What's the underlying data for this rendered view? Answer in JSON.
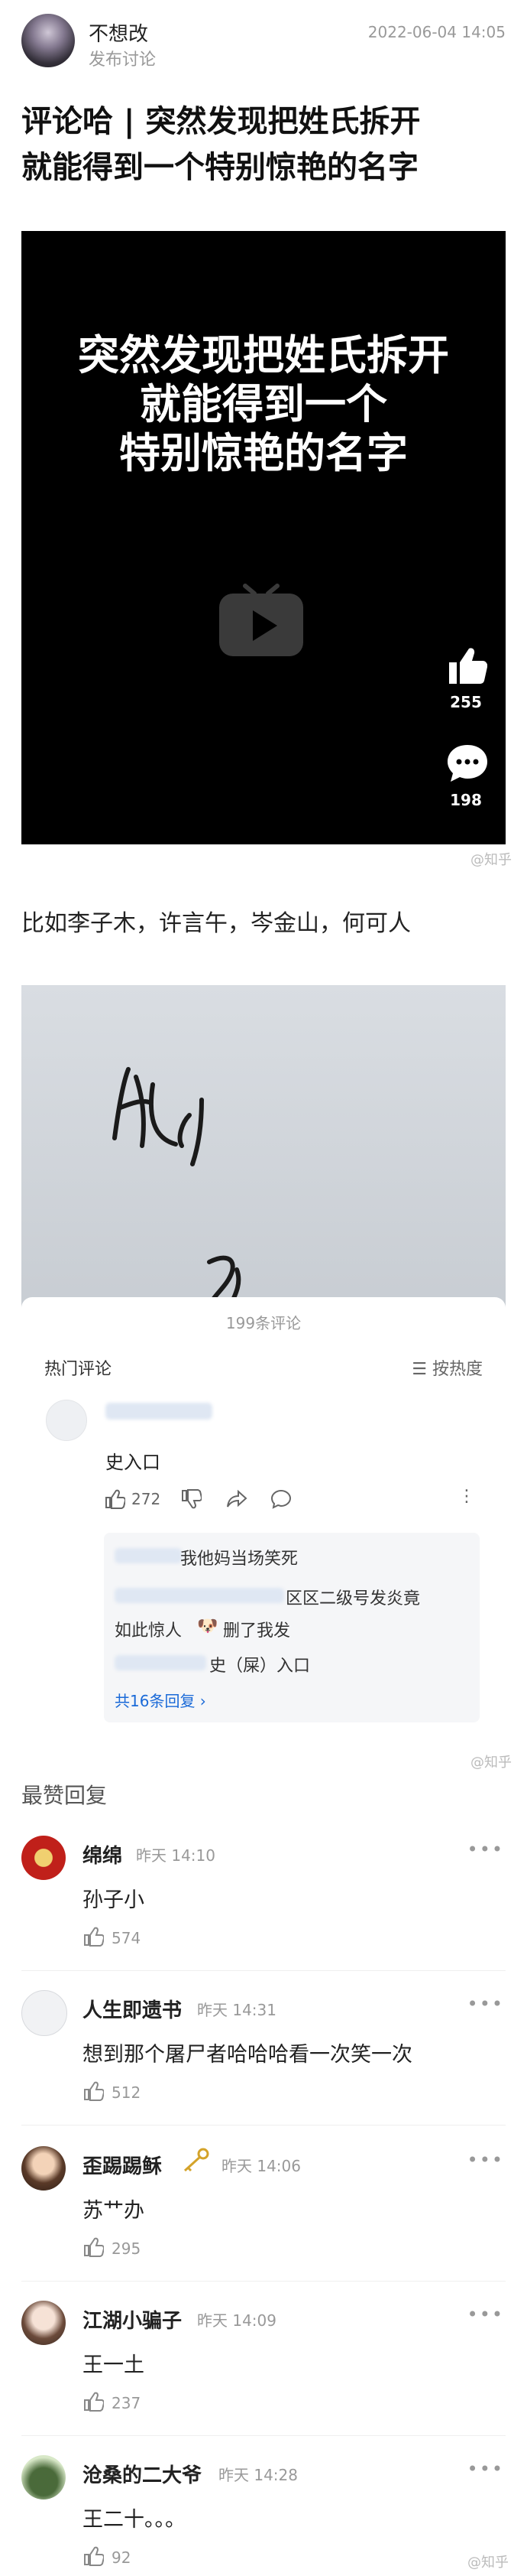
{
  "post": {
    "author": "不想改",
    "subtitle": "发布讨论",
    "timestamp": "2022-06-04 14:05",
    "title_line1": "评论哈 | 突然发现把姓氏拆开",
    "title_line2": "就能得到一个特别惊艳的名字",
    "body_text": "比如李子木，许言午，岑金山，何可人",
    "watermark": "@知乎"
  },
  "video": {
    "overlay_line1": "突然发现把姓氏拆开",
    "overlay_line2": "就能得到一个",
    "overlay_line3": "特别惊艳的名字",
    "like_count": "255",
    "comment_count": "198"
  },
  "screenshot_card": {
    "comment_total": "199条评论",
    "hot_label": "热门评论",
    "sort_label": "按热度",
    "top_comment_text": "史入口",
    "top_comment_likes": "272",
    "reply1_text": "我他妈当场笑死",
    "reply2_text": "区区二级号发炎竟",
    "reply3_text": "如此惊人",
    "reply3_suffix": "删了我发",
    "reply4_text": "史（屎）入口",
    "more_replies": "共16条回复",
    "watermark": "@知乎"
  },
  "replies_section": {
    "title": "最赞回复",
    "items": [
      {
        "name": "绵绵",
        "time": "昨天 14:10",
        "text": "孙子小",
        "likes": "574"
      },
      {
        "name": "人生即遗书",
        "time": "昨天 14:31",
        "text": "想到那个屠尸者哈哈哈看一次笑一次",
        "likes": "512"
      },
      {
        "name": "歪踢踢稣",
        "time": "昨天 14:06",
        "text": "苏艹办",
        "likes": "295"
      },
      {
        "name": "江湖小骗子",
        "time": "昨天 14:09",
        "text": "王一土",
        "likes": "237"
      },
      {
        "name": "沧桑的二大爷",
        "time": "昨天 14:28",
        "text": "王二十。。。",
        "likes": "92"
      }
    ],
    "bottom_watermark": "@知乎"
  },
  "colors": {
    "accent": "#1a6ad8",
    "dark": "#000000",
    "muted": "#999999"
  }
}
